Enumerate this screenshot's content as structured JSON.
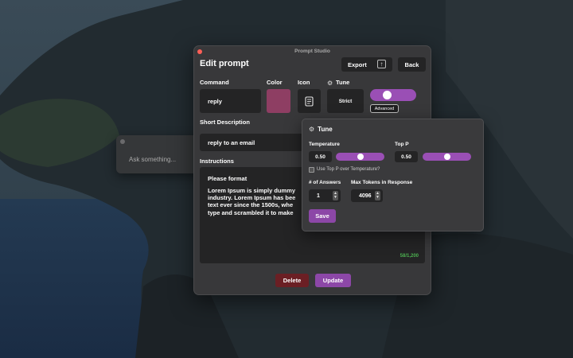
{
  "ask_window": {
    "placeholder": "Ask something..."
  },
  "window": {
    "app_title": "Prompt Studio"
  },
  "header": {
    "title": "Edit prompt",
    "export_label": "Export",
    "back_label": "Back"
  },
  "fields": {
    "command_label": "Command",
    "command_value": "reply",
    "color_label": "Color",
    "color_value": "#8e3e63",
    "icon_label": "Icon",
    "icon_name": "document-icon",
    "tune_label": "Tune",
    "tune_mode": "Strict",
    "tune_toggle_on": true,
    "advanced_label": "Advanced",
    "short_description_label": "Short Description",
    "short_description_value": "reply to an email",
    "instructions_label": "Instructions",
    "instructions_line1": "Please format",
    "instructions_body": "Lorem Ipsum is simply dummy industry. Lorem Ipsum has bee text ever since the 1500s, whe type and scrambled it to make",
    "char_count": "58/1,200"
  },
  "actions": {
    "delete_label": "Delete",
    "update_label": "Update"
  },
  "tune_panel": {
    "title": "Tune",
    "temperature_label": "Temperature",
    "temperature_value": "0.50",
    "temperature_fraction": 0.5,
    "top_p_label": "Top P",
    "top_p_value": "0.50",
    "top_p_fraction": 0.5,
    "use_top_p_label": "Use Top P over Temperature?",
    "use_top_p_checked": false,
    "answers_label": "# of Answers",
    "answers_value": "1",
    "max_tokens_label": "Max Tokens in Response",
    "max_tokens_value": "4096",
    "save_label": "Save"
  },
  "colors": {
    "accent": "#9a4fb5",
    "danger": "#6b1f24",
    "count": "#4caf50"
  }
}
